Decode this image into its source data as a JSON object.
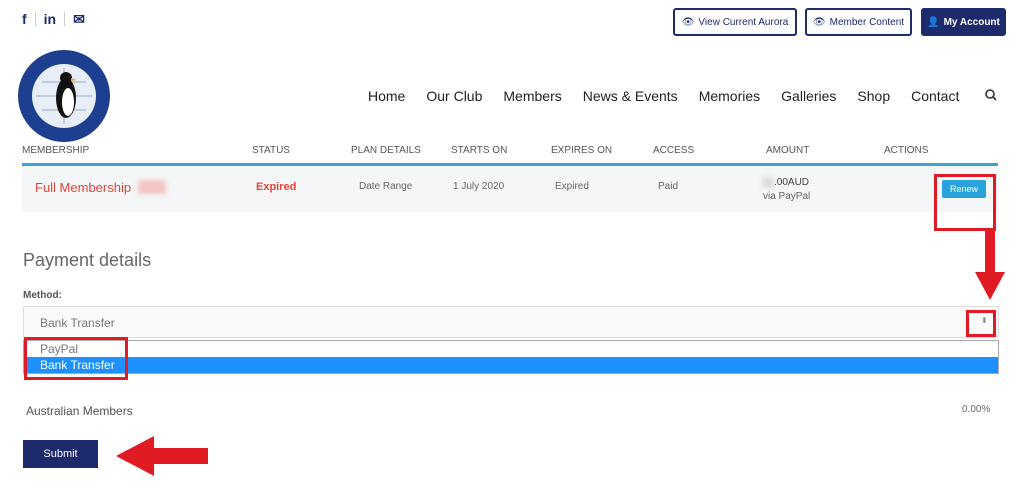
{
  "social": {
    "facebook": "f",
    "linkedin": "in",
    "email": "✉"
  },
  "header_buttons": {
    "view_aurora": "View Current Aurora",
    "member_content": "Member Content",
    "my_account": "My Account"
  },
  "nav": [
    "Home",
    "Our Club",
    "Members",
    "News & Events",
    "Memories",
    "Galleries",
    "Shop",
    "Contact"
  ],
  "table": {
    "headers": [
      "MEMBERSHIP",
      "STATUS",
      "PLAN DETAILS",
      "STARTS ON",
      "EXPIRES ON",
      "ACCESS",
      "AMOUNT",
      "ACTIONS"
    ],
    "row": {
      "membership": "Full Membership",
      "status": "Expired",
      "plan_details": "Date Range",
      "starts_on": "1 July 2020",
      "expires_on": "Expired",
      "access": "Paid",
      "amount": ".00AUD",
      "amount_method": "via PayPal",
      "action": "Renew"
    }
  },
  "payment": {
    "title": "Payment details",
    "method_label": "Method:",
    "selected": "Bank Transfer",
    "options": [
      "PayPal",
      "Bank Transfer"
    ]
  },
  "tax": {
    "label": "Australian Members",
    "rate": "0.00%"
  },
  "submit_label": "Submit",
  "colors": {
    "brand": "#1d2a6b",
    "accent": "#2aa3dc",
    "status_red": "#e0453b",
    "annotation_red": "#e01b24",
    "selected": "#1e90ff"
  }
}
